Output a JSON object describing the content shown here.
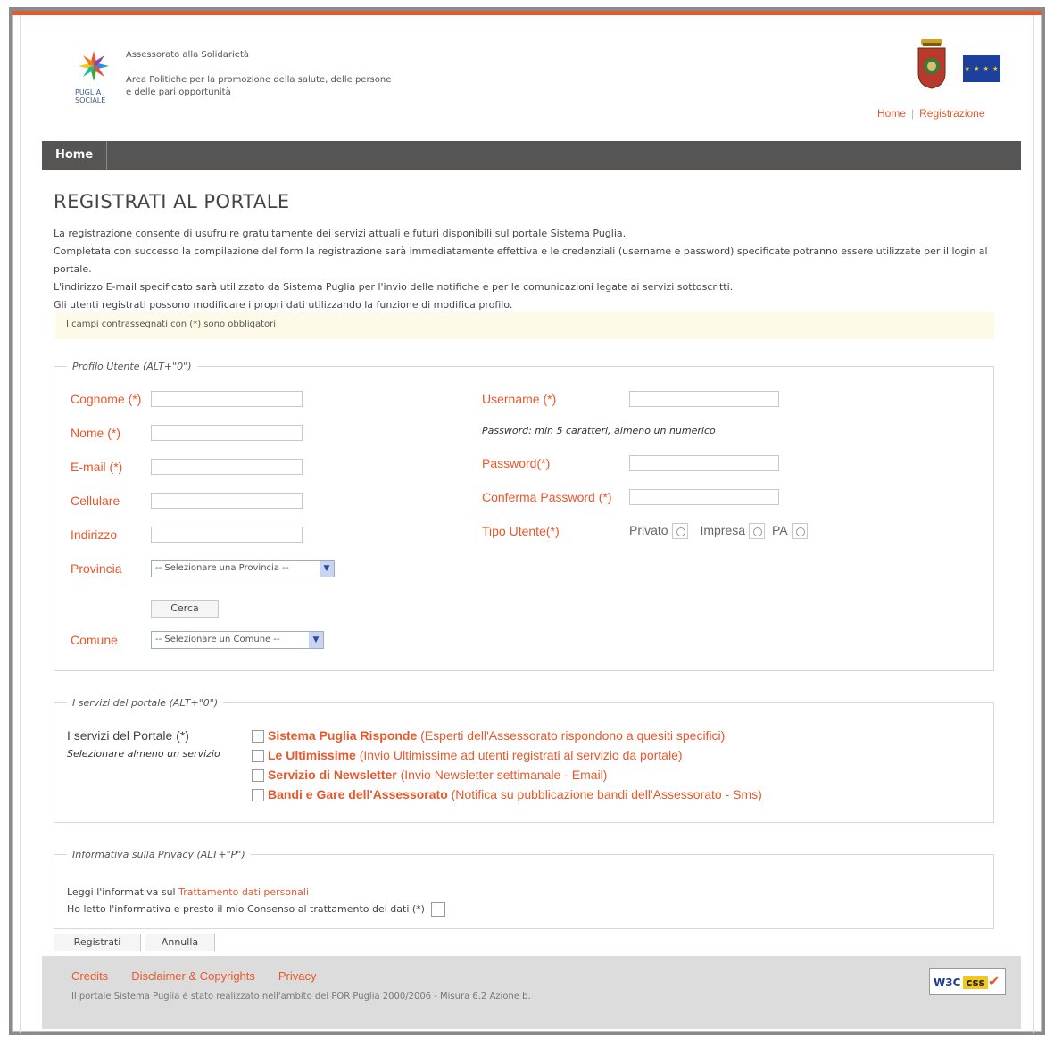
{
  "header": {
    "org_name": "Assessorato alla Solidarietà",
    "org_area": "Area Politiche per la promozione della salute, delle persone e delle pari opportunità",
    "logo_text": "PUGLIA SOCIALE",
    "links": [
      "Home",
      "Registrazione"
    ]
  },
  "nav": {
    "home": "Home"
  },
  "page": {
    "title": "REGISTRATI AL PORTALE",
    "intro": [
      "La registrazione consente di usufruire gratuitamente dei servizi attuali e futuri disponibili sul portale Sistema Puglia.",
      "Completata con successo la compilazione del form la registrazione sarà immediatamente effettiva e le credenziali (username e password) specificate potranno essere utilizzate per il login al portale.",
      "L'indirizzo E-mail specificato sarà utilizzato da Sistema Puglia per l'invio delle notifiche e per le comunicazioni legate ai servizi sottoscritti.",
      "Gli utenti registrati possono modificare i propri dati utilizzando la funzione di modifica profilo."
    ],
    "required_note": "I campi contrassegnati con (*) sono obbligatori"
  },
  "profile": {
    "legend": "Profilo Utente (ALT+\"0\")",
    "cognome": "Cognome (*)",
    "nome": "Nome (*)",
    "email": "E-mail (*)",
    "cellulare": "Cellulare",
    "indirizzo": "Indirizzo",
    "provincia": "Provincia",
    "provincia_select": "-- Selezionare una Provincia --",
    "cerca": "Cerca",
    "comune": "Comune",
    "comune_select": "-- Selezionare un Comune --",
    "username": "Username (*)",
    "password_hint": "Password: min 5 caratteri, almeno un numerico",
    "password": "Password(*)",
    "conferma": "Conferma Password (*)",
    "tipo_utente": "Tipo Utente(*)",
    "tipo_options": [
      "Privato",
      "Impresa",
      "PA"
    ]
  },
  "services": {
    "legend": "I servizi del portale (ALT+\"0\")",
    "label": "I servizi del Portale (*)",
    "hint": "Selezionare almeno un servizio",
    "items": [
      {
        "name": "Sistema Puglia Risponde",
        "desc": "(Esperti dell'Assessorato rispondono a quesiti specifici)"
      },
      {
        "name": "Le Ultimissime",
        "desc": "(Invio Ultimissime ad utenti registrati al servizio da portale)"
      },
      {
        "name": "Servizio di Newsletter",
        "desc": "(Invio Newsletter settimanale - Email)"
      },
      {
        "name": "Bandi e Gare dell'Assessorato",
        "desc": "(Notifica su pubblicazione bandi dell'Assessorato - Sms)"
      }
    ]
  },
  "privacy": {
    "legend": "Informativa sulla Privacy (ALT+\"P\")",
    "read_prefix": "Leggi l'informativa sul",
    "read_link": "Trattamento dati personali",
    "consent": "Ho letto l'informativa e presto il mio Consenso al trattamento dei dati (*)"
  },
  "buttons": {
    "register": "Registrati",
    "cancel": "Annulla"
  },
  "footer": {
    "links": [
      "Credits",
      "Disclaimer & Copyrights",
      "Privacy"
    ],
    "note": "Il portale Sistema Puglia è stato realizzato nell'ambito del POR Puglia 2000/2006 - Misura 6.2 Azione b.",
    "badge": [
      "W3C",
      "css"
    ]
  },
  "colors": {
    "accent": "#e8582b",
    "navbar": "#555555",
    "footer": "#dcdcdc"
  }
}
